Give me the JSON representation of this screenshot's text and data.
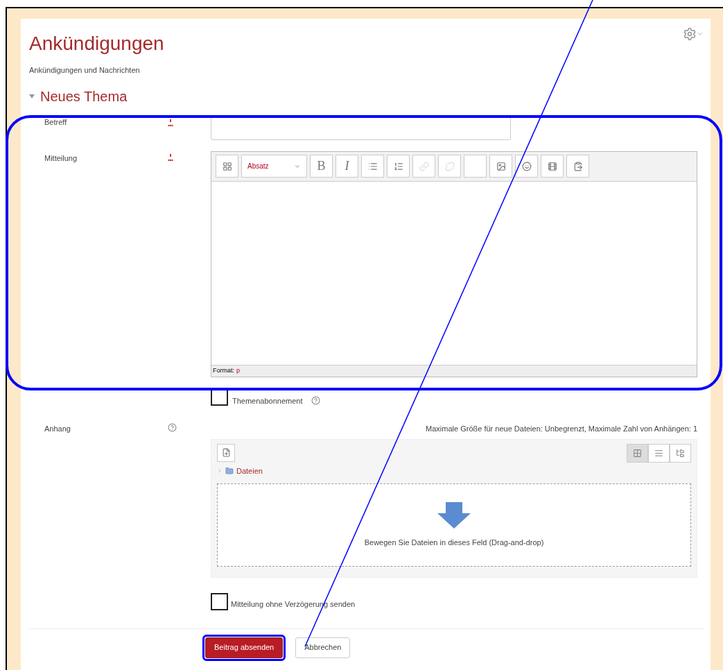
{
  "page": {
    "title": "Ankündigungen",
    "description": "Ankündigungen und Nachrichten"
  },
  "section": {
    "title": "Neues Thema",
    "expanded": true
  },
  "subject": {
    "label": "Betreff",
    "required": true
  },
  "message": {
    "label": "Mitteilung",
    "required": true,
    "format_dropdown": "Absatz",
    "bold": "B",
    "italic": "I",
    "status_label": "Format:",
    "status_value": "p"
  },
  "subscribe": {
    "label": "Themenabonnement",
    "checked": false
  },
  "attachment": {
    "label": "Anhang",
    "limits": "Maximale Größe für neue Dateien: Unbegrenzt, Maximale Zahl von Anhängen: 1",
    "folder": "Dateien",
    "dropzone": "Bewegen Sie Dateien in dieses Feld (Drag-and-drop)"
  },
  "mail_now": {
    "label": "Mitteilung ohne Verzögerung senden",
    "checked": false
  },
  "buttons": [
    {
      "label": "Beitrag absenden",
      "kind": "primary",
      "highlighted": true
    },
    {
      "label": "Abbrechen",
      "kind": "secondary",
      "highlighted": false
    }
  ],
  "annotations": {
    "fields_highlighted": true,
    "pointer_line": true
  }
}
